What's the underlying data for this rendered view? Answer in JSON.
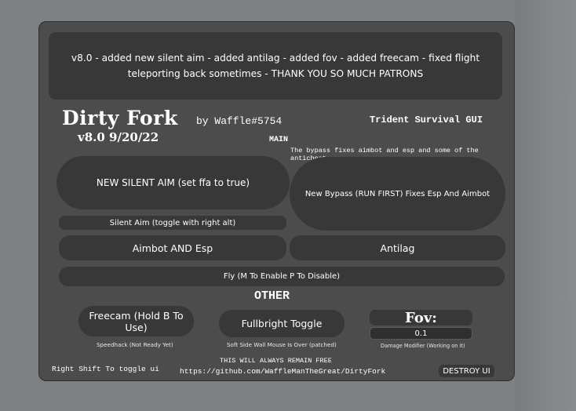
{
  "banner": {
    "text": "v8.0 - added new silent aim - added antilag - added fov - added freecam - fixed flight teleporting back sometimes - THANK YOU SO MUCH PATRONS"
  },
  "header": {
    "title": "Dirty Fork",
    "version": "v8.0 9/20/22",
    "author": "by Waffle#5754",
    "gui_name": "Trident Survival GUI"
  },
  "sections": {
    "main": "MAIN",
    "other": "OTHER"
  },
  "notes": {
    "bypass": "The bypass fixes aimbot and esp and some of the anticheat",
    "speedhack": "Speedhack (Not Ready Yet)",
    "soft_side": "Soft Side Wall Mouse Is Over (patched)",
    "damage": "Damage Modifier (Working on it)",
    "free": "THIS WILL ALWAYS REMAIN FREE",
    "github": "https://github.com/WaffleManTheGreat/DirtyFork",
    "toggle_hint": "Right Shift To toggle ui"
  },
  "buttons": {
    "silent_aim": "NEW SILENT AIM (set ffa to true)",
    "bypass": "New Bypass (RUN FIRST) Fixes Esp And Aimbot",
    "silent_toggle": "Silent Aim (toggle with right alt)",
    "aimbot": "Aimbot AND Esp",
    "antilag": "Antilag",
    "fly": "Fly (M To Enable P To Disable)",
    "freecam": "Freecam (Hold B To Use)",
    "fullbright": "Fullbright Toggle",
    "destroy": "DESTROY UI"
  },
  "fov": {
    "label": "Fov:",
    "value": "0.1"
  },
  "colors": {
    "background": "#7e8184",
    "panel": "#4c4c4c",
    "button": "#383838",
    "text": "#ffffff"
  }
}
